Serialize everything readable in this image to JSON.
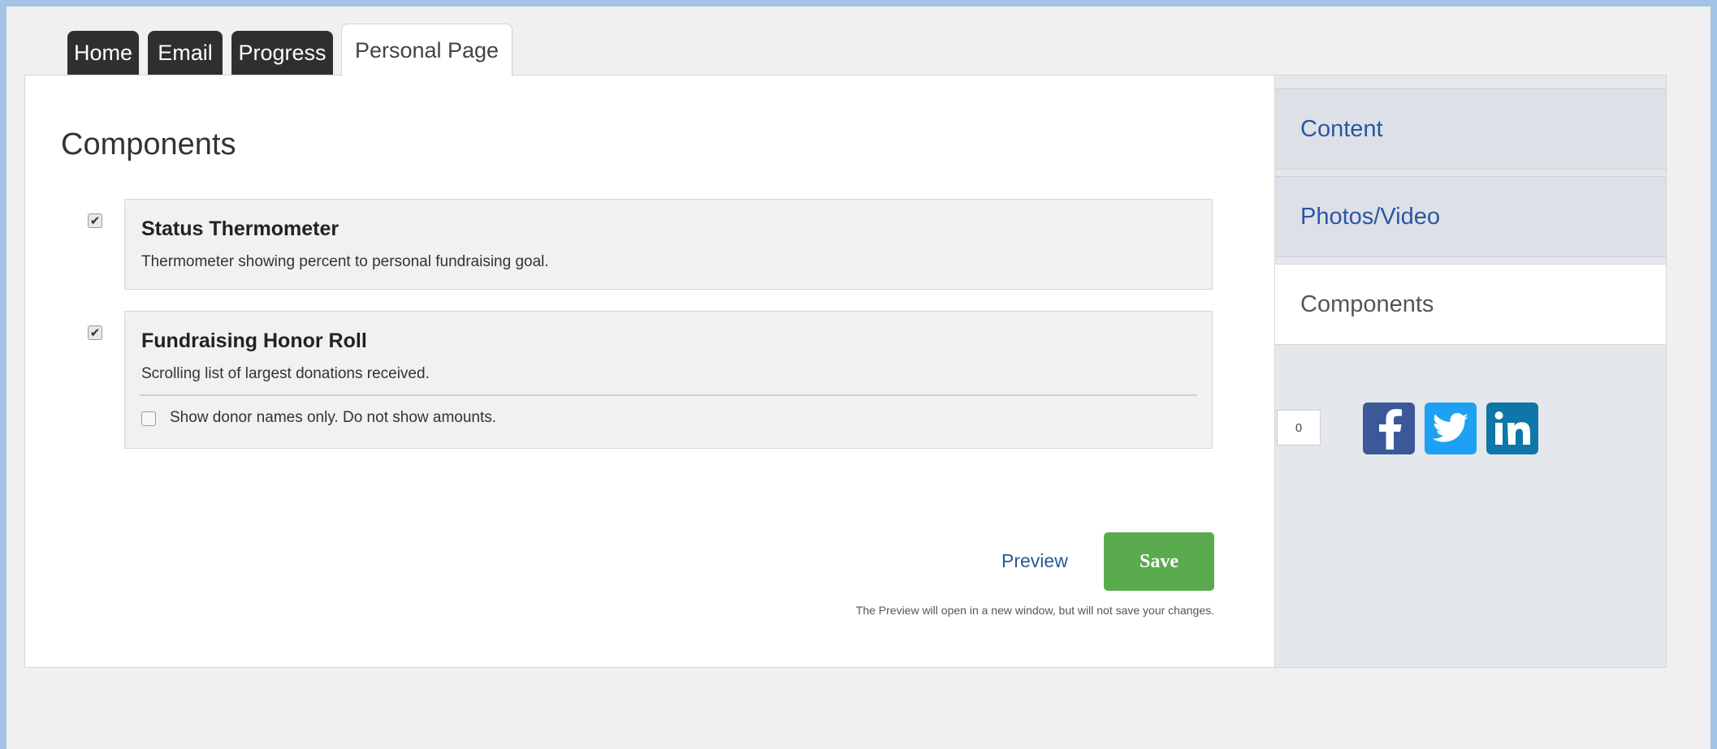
{
  "tabs": [
    {
      "label": "Home"
    },
    {
      "label": "Email"
    },
    {
      "label": "Progress"
    },
    {
      "label": "Personal Page",
      "active": true
    }
  ],
  "main": {
    "title": "Components",
    "components": [
      {
        "title": "Status Thermometer",
        "description": "Thermometer showing percent to personal fundraising goal.",
        "checked": true
      },
      {
        "title": "Fundraising Honor Roll",
        "description": "Scrolling list of largest donations received.",
        "checked": true,
        "option": {
          "label": "Show donor names only. Do not show amounts.",
          "checked": false
        }
      }
    ],
    "preview_label": "Preview",
    "save_label": "Save",
    "preview_note": "The Preview will open in a new window, but will not save your changes."
  },
  "sidebar": {
    "items": [
      {
        "label": "Content"
      },
      {
        "label": "Photos/Video"
      },
      {
        "label": "Components",
        "current": true
      }
    ],
    "share_count": "0",
    "social": [
      {
        "icon": "facebook-icon",
        "color": "#3b5998"
      },
      {
        "icon": "twitter-icon",
        "color": "#1da1f2"
      },
      {
        "icon": "linkedin-icon",
        "color": "#0e76a8"
      }
    ]
  },
  "colors": {
    "accent_link": "#2c55a3",
    "save_button": "#5aab4d",
    "background_outer": "#a3c4e6"
  }
}
